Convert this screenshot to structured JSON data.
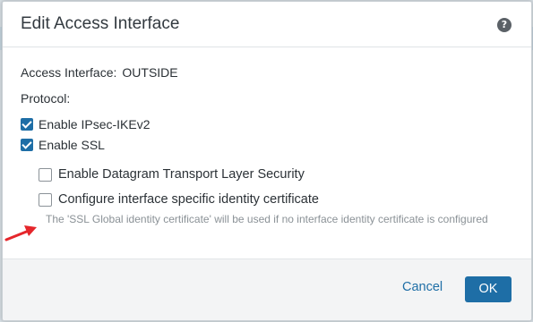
{
  "dialog": {
    "title": "Edit Access Interface",
    "help_icon": "question-circle-icon"
  },
  "access_interface": {
    "label": "Access Interface:",
    "value": "OUTSIDE"
  },
  "protocol": {
    "label": "Protocol:",
    "options": [
      {
        "label": "Enable IPsec-IKEv2",
        "checked": true
      },
      {
        "label": "Enable SSL",
        "checked": true
      }
    ]
  },
  "ssl_options": [
    {
      "label": "Enable Datagram Transport Layer Security",
      "checked": false
    },
    {
      "label": "Configure interface specific identity certificate",
      "checked": false
    }
  ],
  "hint": "The 'SSL Global identity certificate' will be used if no interface identity certificate is configured",
  "annotation": {
    "icon": "red-arrow-icon",
    "color": "#e5262b"
  },
  "footer": {
    "cancel_label": "Cancel",
    "ok_label": "OK"
  },
  "colors": {
    "accent": "#1e6ea6",
    "title_text": "#333a40",
    "hint_text": "#8a9196"
  }
}
